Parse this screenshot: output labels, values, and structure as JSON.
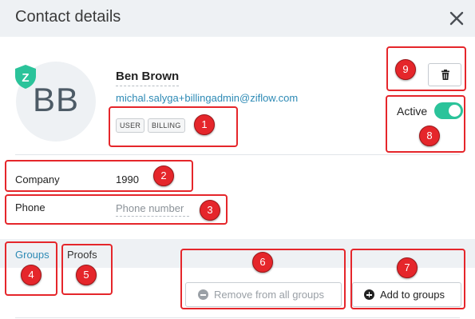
{
  "header": {
    "title": "Contact details"
  },
  "contact": {
    "initials": "BB",
    "badge_letter": "Z",
    "name": "Ben Brown",
    "email": "michal.salyga+billingadmin@ziflow.com",
    "tags": [
      "USER",
      "BILLING"
    ],
    "status_label": "Active",
    "status_active": true
  },
  "fields": {
    "company_label": "Company",
    "company_value": "1990",
    "phone_label": "Phone",
    "phone_placeholder": "Phone number"
  },
  "tabs": [
    {
      "label": "Groups",
      "active": true
    },
    {
      "label": "Proofs",
      "active": false
    }
  ],
  "actions": {
    "remove_label": "Remove from all groups",
    "add_label": "Add to groups"
  },
  "annotations": [
    "1",
    "2",
    "3",
    "4",
    "5",
    "6",
    "7",
    "8",
    "9"
  ],
  "colors": {
    "accent": "#2d8ab5",
    "toggle_on": "#2bc39a",
    "shield": "#2bc39a",
    "annotation": "#e5262b"
  },
  "icons": {
    "close": "close-icon",
    "delete": "trash-icon",
    "shield": "shield-icon",
    "remove": "minus-circle-icon",
    "add": "plus-circle-icon"
  }
}
